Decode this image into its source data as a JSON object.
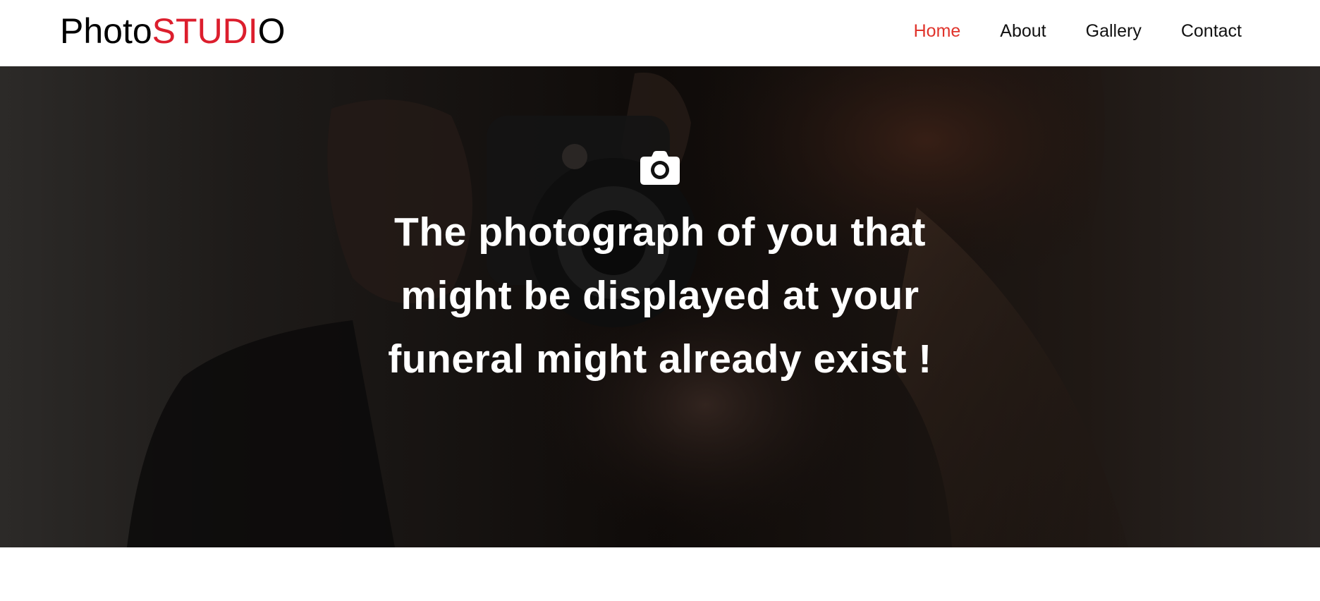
{
  "brand": {
    "prefix": "Photo",
    "accent": "STUDI",
    "suffix": "O",
    "accent_color": "#dc1e2d"
  },
  "nav": {
    "active_color": "#e0342c",
    "items": [
      {
        "label": "Home",
        "active": true
      },
      {
        "label": "About",
        "active": false
      },
      {
        "label": "Gallery",
        "active": false
      },
      {
        "label": "Contact",
        "active": false
      }
    ]
  },
  "hero": {
    "icon": "camera-icon",
    "title_lines": [
      "The photograph of you that",
      "might be displayed at your",
      "funeral might already exist !"
    ]
  }
}
